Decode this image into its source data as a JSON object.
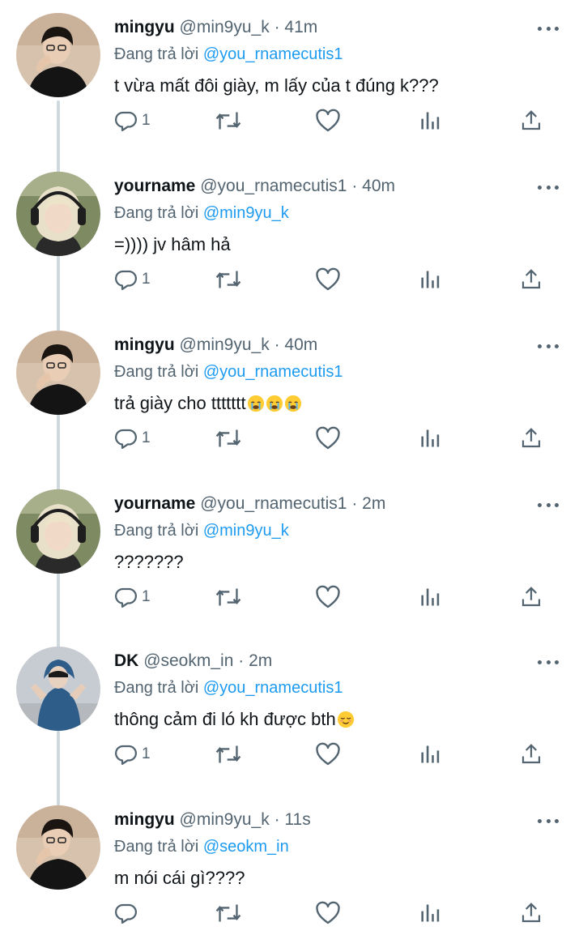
{
  "tweets": [
    {
      "name": "mingyu",
      "handle": "@min9yu_k",
      "time": "41m",
      "reply_prefix": "Đang trả lời",
      "reply_to": "@you_rnamecutis1",
      "text": "t vừa mất đôi giày, m lấy của t đúng k???",
      "emoji": "",
      "reply_count": "1",
      "avatar": "mingyu"
    },
    {
      "name": "yourname",
      "handle": "@you_rnamecutis1",
      "time": "40m",
      "reply_prefix": "Đang trả lời",
      "reply_to": "@min9yu_k",
      "text": "=)))) jv hâm hả",
      "emoji": "",
      "reply_count": "1",
      "avatar": "yourname"
    },
    {
      "name": "mingyu",
      "handle": "@min9yu_k",
      "time": "40m",
      "reply_prefix": "Đang trả lời",
      "reply_to": "@you_rnamecutis1",
      "text": "trả giày cho ttttttt",
      "emoji": "crying-face x3",
      "reply_count": "1",
      "avatar": "mingyu"
    },
    {
      "name": "yourname",
      "handle": "@you_rnamecutis1",
      "time": "2m",
      "reply_prefix": "Đang trả lời",
      "reply_to": "@min9yu_k",
      "text": "???????",
      "emoji": "",
      "reply_count": "1",
      "avatar": "yourname"
    },
    {
      "name": "DK",
      "handle": "@seokm_in",
      "time": "2m",
      "reply_prefix": "Đang trả lời",
      "reply_to": "@you_rnamecutis1",
      "text": "thông cảm đi ló kh được bth",
      "emoji": "relieved-face",
      "reply_count": "1",
      "avatar": "dk"
    },
    {
      "name": "mingyu",
      "handle": "@min9yu_k",
      "time": "11s",
      "reply_prefix": "Đang trả lời",
      "reply_to": "@seokm_in",
      "text": "m nói cái gì????",
      "emoji": "",
      "reply_count": "",
      "avatar": "mingyu"
    }
  ],
  "separator": "·",
  "icons": {
    "reply": "reply-icon",
    "retweet": "retweet-icon",
    "like": "heart-icon",
    "views": "views-icon",
    "share": "share-icon",
    "more": "more-icon"
  },
  "colors": {
    "text": "#0f1419",
    "secondary": "#536471",
    "mention": "#1d9bf0",
    "thread_line": "#cfd9de"
  }
}
